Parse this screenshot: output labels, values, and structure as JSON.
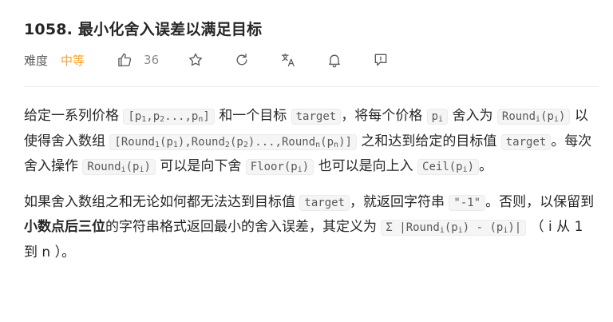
{
  "problem": {
    "title": "1058. 最小化舍入误差以满足目标"
  },
  "meta": {
    "difficulty_label": "难度",
    "difficulty_value": "中等",
    "like_count": "36",
    "icons": [
      "thumbs-up-icon",
      "star-icon",
      "refresh-icon",
      "translate-icon",
      "bell-icon",
      "comment-icon"
    ],
    "colors": {
      "difficulty": "#ffa116",
      "text": "#262626",
      "code_bg": "#f5f5f5"
    }
  },
  "content": {
    "p1": {
      "t1": "给定一系列价格",
      "c1a": "[p",
      "c1b": "1",
      "c1c": ",p",
      "c1d": "2",
      "c1e": "...,p",
      "c1f": "n",
      "c1g": "]",
      "t2": "和一个目标",
      "c2": "target",
      "t3": "，将每个价格",
      "c3a": "p",
      "c3b": "i",
      "t4": "舍入为",
      "c4a": "Round",
      "c4b": "i",
      "c4c": "(p",
      "c4d": "i",
      "c4e": ")",
      "t5": "以使得舍入数组",
      "c5a": "[Round",
      "c5b": "1",
      "c5c": "(p",
      "c5d": "1",
      "c5e": "),Round",
      "c5f": "2",
      "c5g": "(p",
      "c5h": "2",
      "c5i": ")...,Round",
      "c5j": "n",
      "c5k": "(p",
      "c5l": "n",
      "c5m": ")]",
      "t6": "之和达到给定的目标值",
      "c6": "target",
      "t7": "。每次舍入操作",
      "c7a": "Round",
      "c7b": "i",
      "c7c": "(p",
      "c7d": "i",
      "c7e": ")",
      "t8": "可以是向下舍",
      "c8a": "Floor(p",
      "c8b": "i",
      "c8c": ")",
      "t9": "也可以是向上入",
      "c9a": "Ceil(p",
      "c9b": "i",
      "c9c": ")",
      "t10": "。"
    },
    "p2": {
      "t1": "如果舍入数组之和无论如何都无法达到目标值",
      "c1": "target",
      "t2": "，就返回字符串",
      "c2": "\"-1\"",
      "t3": "。否则，以保留到",
      "b1": "小数点后三位",
      "t4": "的字符串格式返回最小的舍入误差，其定义为",
      "c3": "Σ |Round",
      "c3b": "i",
      "c3c": "(p",
      "c3d": "i",
      "c3e": ") - (p",
      "c3f": "i",
      "c3g": ")|",
      "t5": "（ i 从 1 到 n ）。"
    }
  }
}
